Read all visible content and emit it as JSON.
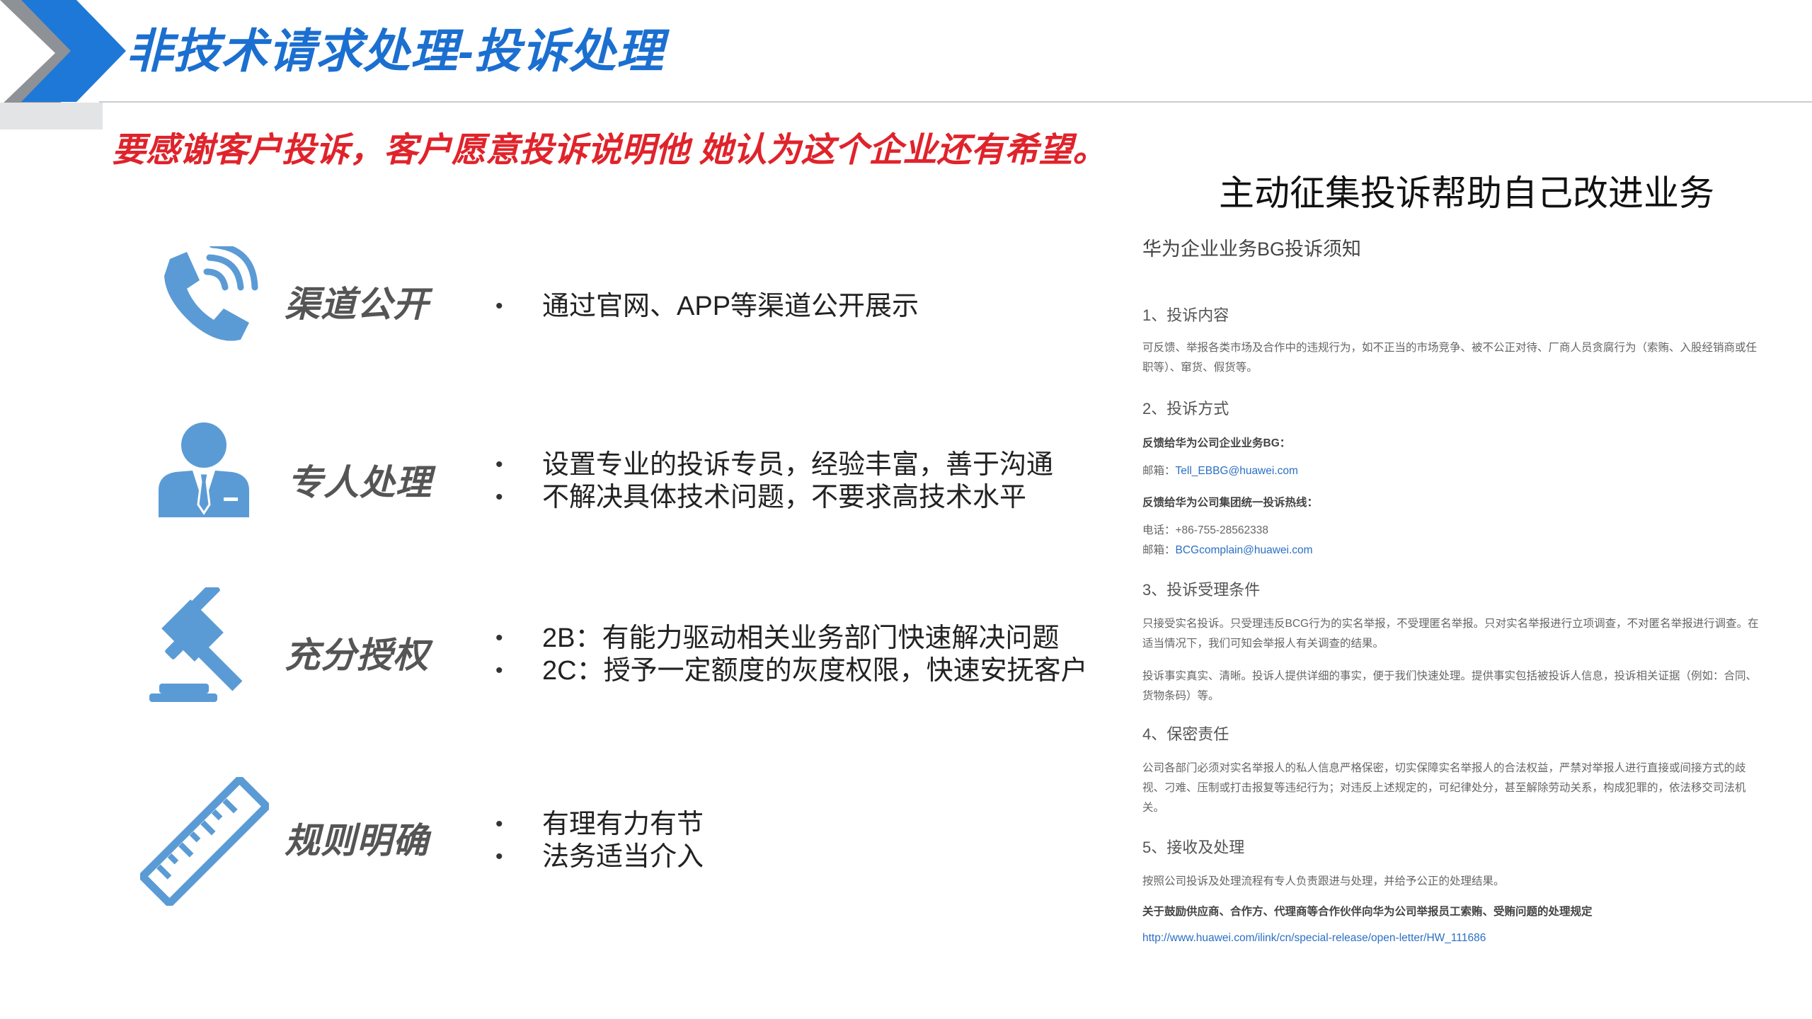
{
  "header": {
    "title": "非技术请求处理-投诉处理",
    "subtitle": "要感谢客户投诉，客户愿意投诉说明他 她认为这个企业还有希望。",
    "accent_color": "#1b6fd0",
    "subtitle_color": "#e0232b"
  },
  "rows": [
    {
      "label": "渠道公开",
      "icon": "phone-icon",
      "bullets": [
        "通过官网、APP等渠道公开展示"
      ]
    },
    {
      "label": "专人处理",
      "icon": "person-icon",
      "bullets": [
        "设置专业的投诉专员，经验丰富，善于沟通",
        "不解决具体技术问题，不要求高技术水平"
      ]
    },
    {
      "label": "充分授权",
      "icon": "gavel-icon",
      "bullets": [
        "2B：有能力驱动相关业务部门快速解决问题",
        "2C：授予一定额度的灰度权限，快速安抚客户"
      ]
    },
    {
      "label": "规则明确",
      "icon": "ruler-icon",
      "bullets": [
        "有理有力有节",
        "法务适当介入"
      ]
    }
  ],
  "panel": {
    "title": "主动征集投诉帮助自己改进业务",
    "notice_title": "华为企业业务BG投诉须知",
    "s1_head": "1、投诉内容",
    "s1_text": "可反馈、举报各类市场及合作中的违规行为，如不正当的市场竞争、被不公正对待、厂商人员贪腐行为（索贿、入股经销商或任职等）、窜货、假货等。",
    "s2_head": "2、投诉方式",
    "s2_bg_label": "反馈给华为公司企业业务BG：",
    "s2_mail_label": "邮箱：",
    "s2_mail": "Tell_EBBG@huawei.com",
    "s2_group_label": "反馈给华为公司集团统一投诉热线：",
    "s2_phone": "电话：+86-755-28562338",
    "s2_mail2_label": "邮箱：",
    "s2_mail2": "BCGcomplain@huawei.com",
    "s3_head": "3、投诉受理条件",
    "s3_text1": "只接受实名投诉。只受理违反BCG行为的实名举报，不受理匿名举报。只对实名举报进行立项调查，不对匿名举报进行调查。在适当情况下，我们可知会举报人有关调查的结果。",
    "s3_text2": "投诉事实真实、清晰。投诉人提供详细的事实，便于我们快速处理。提供事实包括被投诉人信息，投诉相关证据（例如：合同、货物条码）等。",
    "s4_head": "4、保密责任",
    "s4_text": "公司各部门必须对实名举报人的私人信息严格保密，切实保障实名举报人的合法权益，严禁对举报人进行直接或间接方式的歧视、刁难、压制或打击报复等违纪行为；对违反上述规定的，可纪律处分，甚至解除劳动关系，构成犯罪的，依法移交司法机关。",
    "s5_head": "5、接收及处理",
    "s5_text": "按照公司投诉及处理流程有专人负责跟进与处理，并给予公正的处理结果。",
    "s5_bold": "关于鼓励供应商、合作方、代理商等合作伙伴向华为公司举报员工索贿、受贿问题的处理规定",
    "s5_link": "http://www.huawei.com/ilink/cn/special-release/open-letter/HW_111686",
    "link_color": "#2b6fc4"
  }
}
